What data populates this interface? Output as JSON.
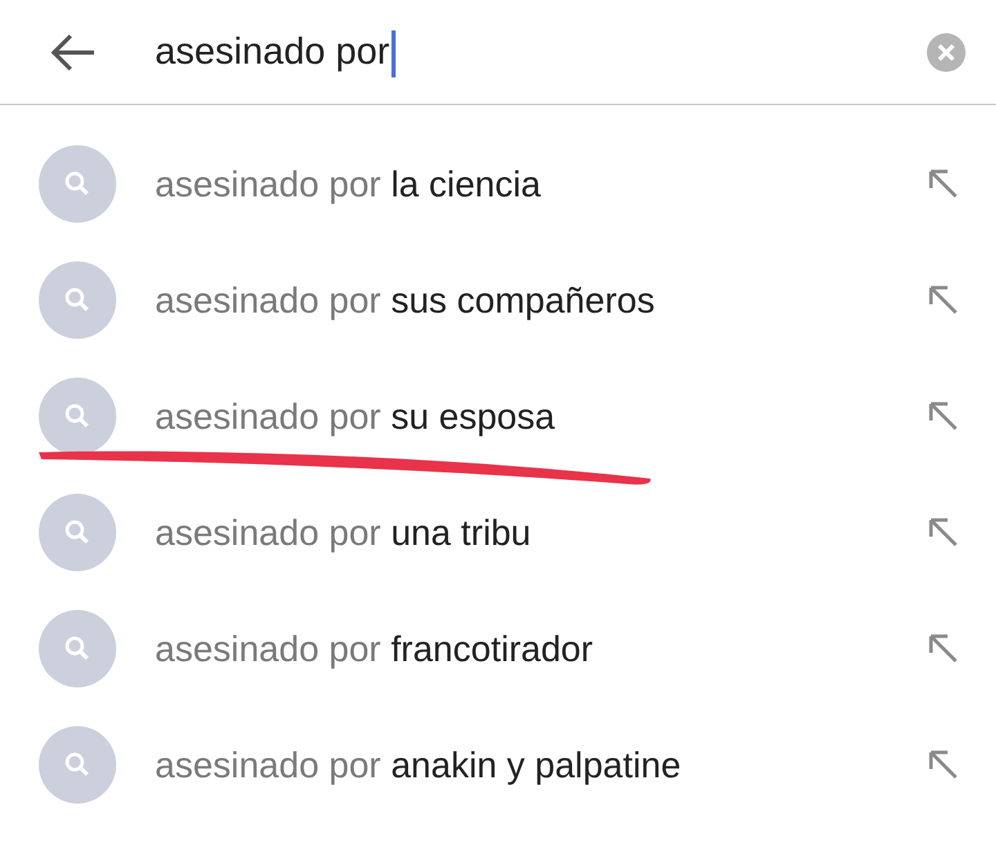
{
  "search": {
    "value": "asesinado por",
    "focused": true
  },
  "suggestions": [
    {
      "prefix": "asesinado por",
      "completion": "la ciencia",
      "underlined": false
    },
    {
      "prefix": "asesinado por",
      "completion": "sus compañeros",
      "underlined": false
    },
    {
      "prefix": "asesinado por",
      "completion": "su esposa",
      "underlined": true
    },
    {
      "prefix": "asesinado por",
      "completion": "una tribu",
      "underlined": false
    },
    {
      "prefix": "asesinado por",
      "completion": "francotirador",
      "underlined": false
    },
    {
      "prefix": "asesinado por",
      "completion": "anakin y palpatine",
      "underlined": false
    }
  ]
}
